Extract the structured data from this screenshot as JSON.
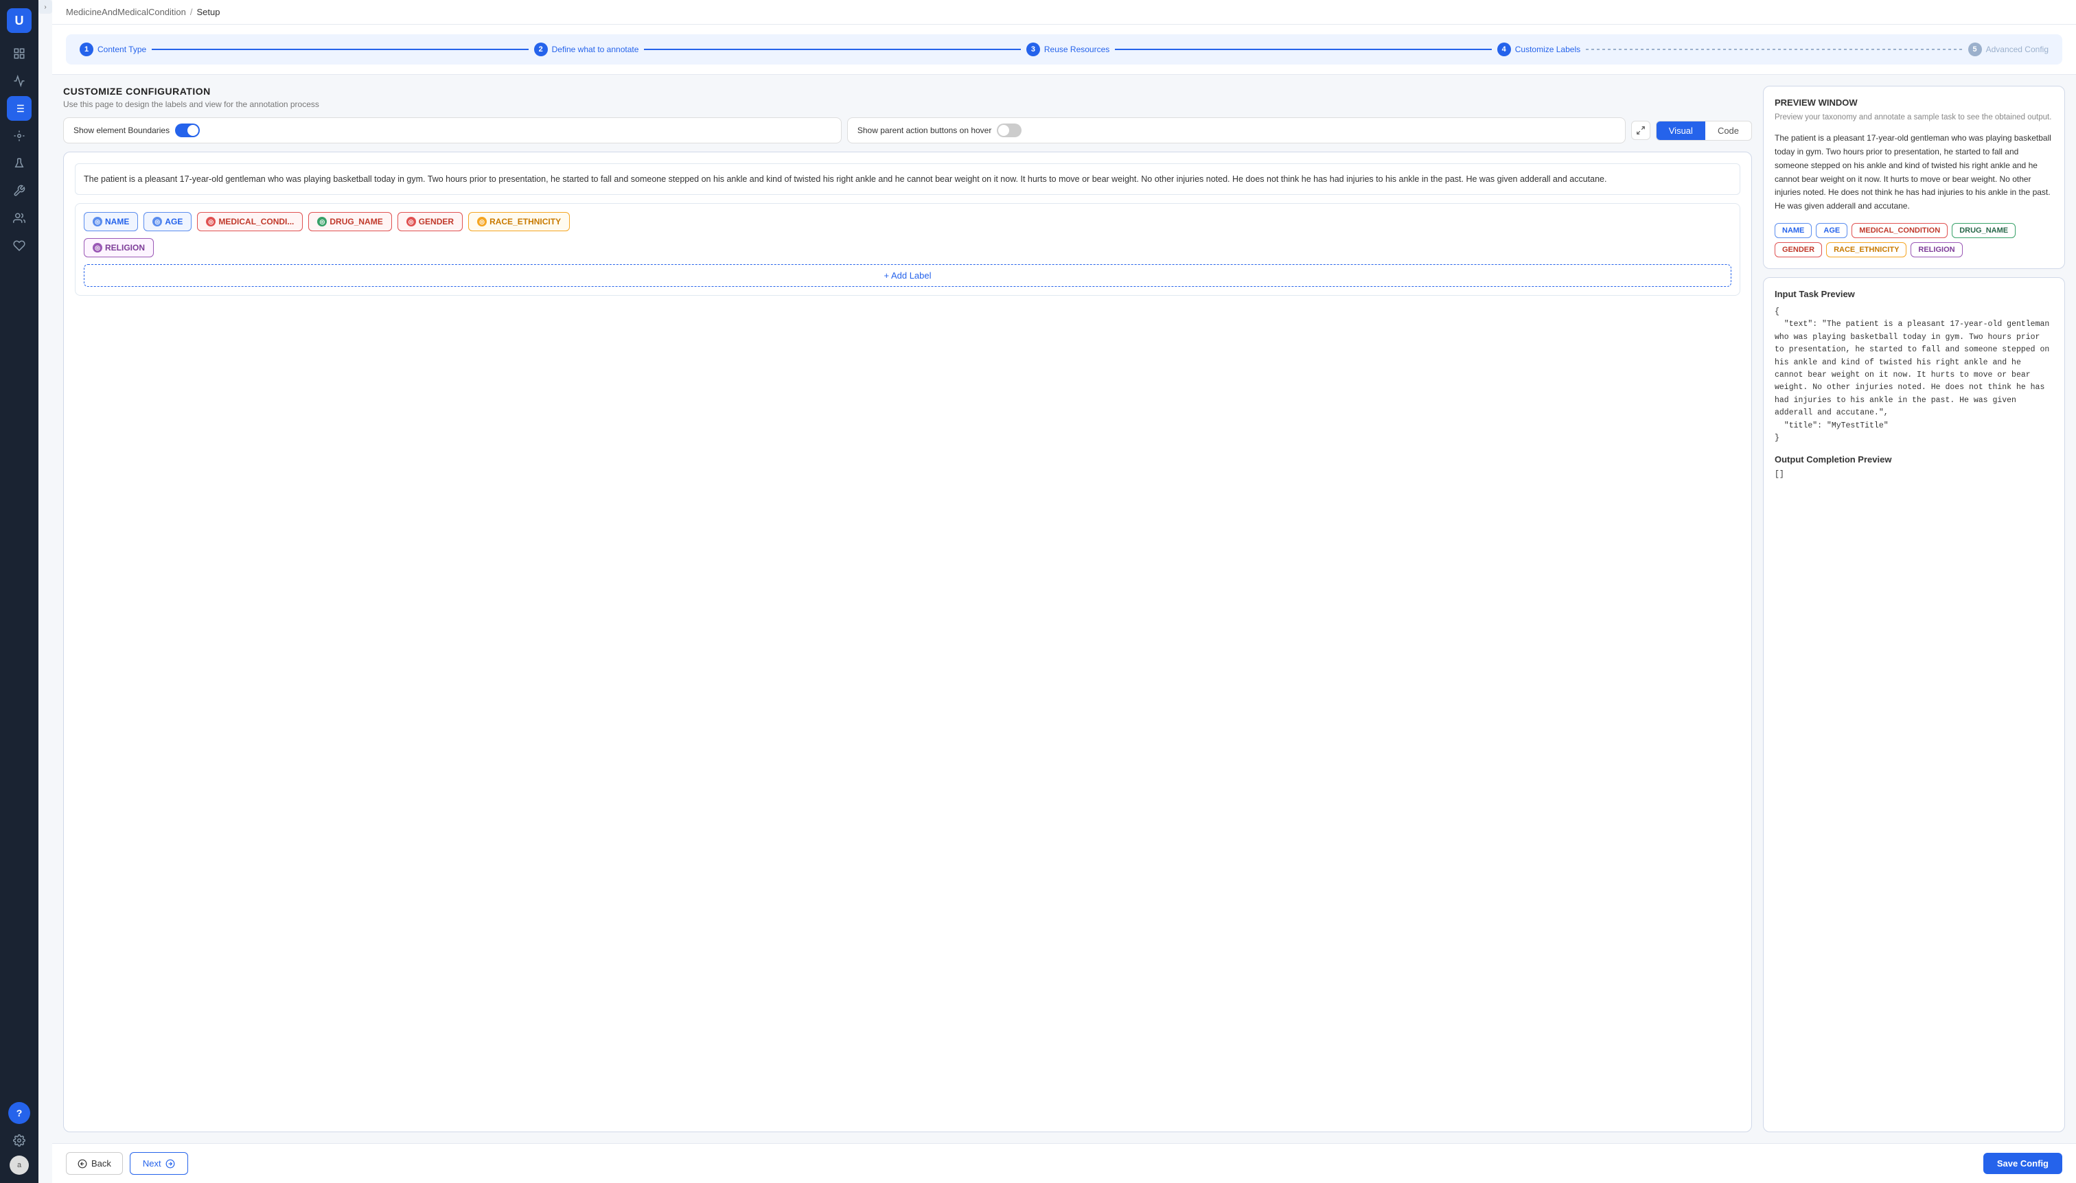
{
  "app": {
    "logo_text": "U"
  },
  "breadcrumb": {
    "project": "MedicineAndMedicalCondition",
    "separator": "/",
    "page": "Setup"
  },
  "steps": [
    {
      "num": "1",
      "label": "Content Type",
      "active": true
    },
    {
      "num": "2",
      "label": "Define what to annotate",
      "active": true
    },
    {
      "num": "3",
      "label": "Reuse Resources",
      "active": true
    },
    {
      "num": "4",
      "label": "Customize Labels",
      "active": true
    },
    {
      "num": "5",
      "label": "Advanced Config",
      "active": false
    }
  ],
  "left_panel": {
    "title": "CUSTOMIZE CONFIGURATION",
    "subtitle": "Use this page to design the labels and view for the annotation process",
    "view_toggle": {
      "visual_label": "Visual",
      "code_label": "Code",
      "active": "Visual"
    },
    "options": {
      "show_boundaries_label": "Show element Boundaries",
      "show_boundaries_on": true,
      "show_parent_label": "Show parent action buttons on hover",
      "show_parent_on": false
    },
    "sample_text": "The patient is a pleasant 17-year-old gentleman who was playing basketball today in gym. Two hours prior to presentation, he started to fall and someone stepped on his ankle and kind of twisted his right ankle and he cannot bear weight on it now. It hurts to move or bear weight. No other injuries noted. He does not think he has had injuries to his ankle in the past. He was given adderall and accutane.",
    "labels": [
      {
        "id": "name",
        "text": "NAME",
        "color_class": "chip-name",
        "icon_char": "◎"
      },
      {
        "id": "age",
        "text": "AGE",
        "color_class": "chip-age",
        "icon_char": "◎"
      },
      {
        "id": "medical",
        "text": "MEDICAL_CONDI...",
        "color_class": "chip-medical",
        "icon_char": "◎"
      },
      {
        "id": "drug",
        "text": "DRUG_NAME",
        "color_class": "chip-drug",
        "icon_char": "◎"
      },
      {
        "id": "gender",
        "text": "GENDER",
        "color_class": "chip-gender",
        "icon_char": "◎"
      },
      {
        "id": "race",
        "text": "RACE_ETHNICITY",
        "color_class": "chip-race",
        "icon_char": "◎"
      },
      {
        "id": "religion",
        "text": "RELIGION",
        "color_class": "chip-religion",
        "icon_char": "◎"
      }
    ],
    "add_label_text": "+ Add Label"
  },
  "right_panel": {
    "preview_title": "PREVIEW WINDOW",
    "preview_subtitle": "Preview your taxonomy and annotate a sample task to see the obtained output.",
    "preview_text": "The patient is a pleasant 17-year-old gentleman who was playing basketball today in gym. Two hours prior to presentation, he started to fall and someone stepped on his ankle and kind of twisted his right ankle and he cannot bear weight on it now. It hurts to move or bear weight. No other injuries noted. He does not think he has had injuries to his ankle in the past. He was given adderall and accutane.",
    "preview_chips": [
      {
        "text": "NAME",
        "color_class": "pchip-name"
      },
      {
        "text": "AGE",
        "color_class": "pchip-age"
      },
      {
        "text": "MEDICAL_CONDITION",
        "color_class": "pchip-medical"
      },
      {
        "text": "DRUG_NAME",
        "color_class": "pchip-drug"
      },
      {
        "text": "GENDER",
        "color_class": "pchip-gender"
      },
      {
        "text": "RACE_ETHNICITY",
        "color_class": "pchip-race"
      },
      {
        "text": "RELIGION",
        "color_class": "pchip-religion"
      }
    ],
    "input_task_title": "Input Task Preview",
    "input_task_code": "{\n  \"text\": \"The patient is a pleasant 17-year-old gentleman who was playing basketball today in gym. Two hours prior to presentation, he started to fall and someone stepped on his ankle and kind of twisted his right ankle and he cannot bear weight on it now. It hurts to move or bear weight. No other injuries noted. He does not think he has had injuries to his ankle in the past. He was given adderall and accutane.\",\n  \"title\": \"MyTestTitle\"\n}",
    "output_title": "Output Completion Preview",
    "output_code": "[]"
  },
  "bottom_bar": {
    "back_label": "Back",
    "next_label": "Next",
    "save_label": "Save Config"
  },
  "sidebar_icons": [
    {
      "id": "home",
      "symbol": "⊞",
      "active": false
    },
    {
      "id": "analytics",
      "symbol": "📊",
      "active": false
    },
    {
      "id": "list",
      "symbol": "☰",
      "active": false
    },
    {
      "id": "location",
      "symbol": "◎",
      "active": false
    },
    {
      "id": "flask",
      "symbol": "⚗",
      "active": false
    },
    {
      "id": "tools",
      "symbol": "✱",
      "active": true
    },
    {
      "id": "users",
      "symbol": "👥",
      "active": false
    },
    {
      "id": "plug",
      "symbol": "🔌",
      "active": false
    },
    {
      "id": "settings",
      "symbol": "⚙",
      "active": false
    }
  ]
}
